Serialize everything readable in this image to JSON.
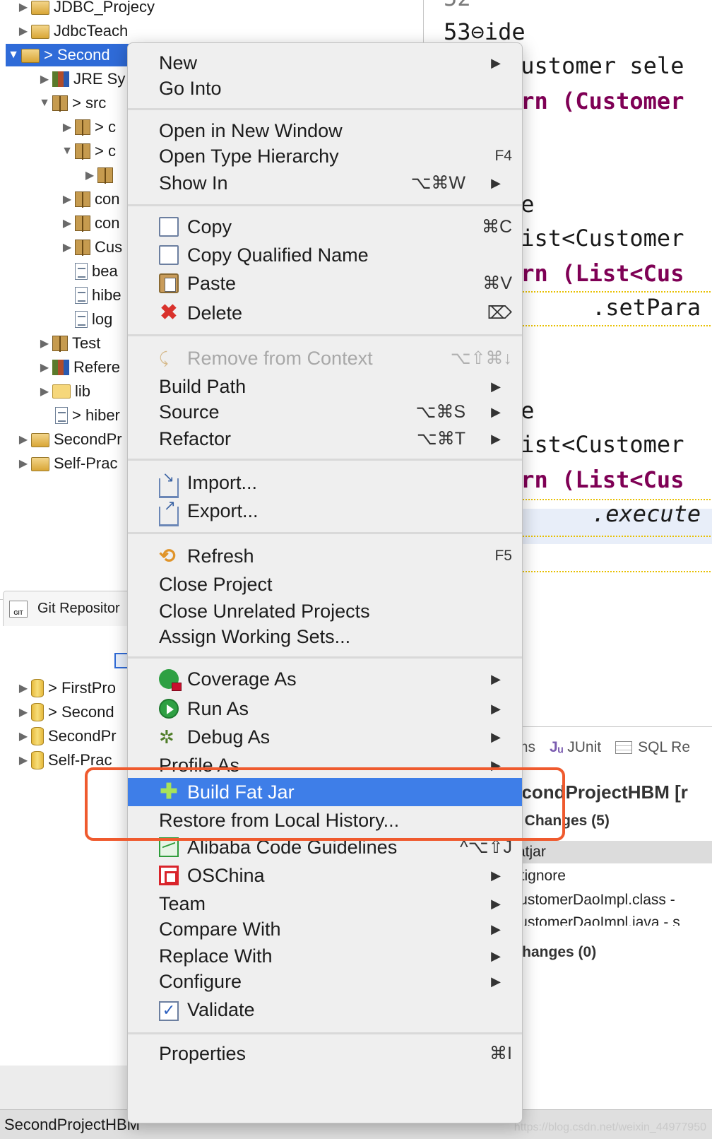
{
  "explorer": {
    "rows": [
      {
        "label": "JDBC_Projecy"
      },
      {
        "label": "JdbcTeach"
      },
      {
        "label": "> Second"
      },
      {
        "label": "JRE Sy"
      },
      {
        "label": "> src"
      },
      {
        "label": "> c"
      },
      {
        "label": "> c"
      },
      {
        "label": ""
      },
      {
        "label": "con"
      },
      {
        "label": "con"
      },
      {
        "label": "Cus"
      },
      {
        "label": "bea"
      },
      {
        "label": "hibe"
      },
      {
        "label": "log"
      },
      {
        "label": "Test"
      },
      {
        "label": "Refere"
      },
      {
        "label": "lib"
      },
      {
        "label": "> hiber"
      },
      {
        "label": "SecondPr"
      },
      {
        "label": "Self-Prac"
      }
    ]
  },
  "git_view": {
    "tab_label": "Git Repositor",
    "logo_text": "GIT",
    "rows": [
      {
        "label": "> FirstPro"
      },
      {
        "label": "> Second"
      },
      {
        "label": "SecondPr"
      },
      {
        "label": "Self-Prac"
      }
    ]
  },
  "editor": {
    "lines": [
      {
        "text": "52"
      },
      {
        "text": "53⊖ide"
      },
      {
        "text": "Customer sele"
      },
      {
        "text": "urn (Customer"
      },
      {
        "text": "de"
      },
      {
        "text": "List<Customer"
      },
      {
        "text": "urn (List<Cus"
      },
      {
        "text": ".setPara"
      },
      {
        "text": "de"
      },
      {
        "text": "List<Customer"
      },
      {
        "text": "urn (List<Cus"
      },
      {
        "text": ".execute"
      }
    ]
  },
  "staging": {
    "tabs": [
      "ms",
      "JUnit",
      "SQL Re"
    ],
    "title": "econdProjectHBM [r",
    "unstaged_header": "d Changes (5)",
    "files": [
      "atjar",
      "itignore",
      "CustomerDaoImpl.class -",
      "CustomerDaoImpl.java - s"
    ],
    "staged_header": "Changes (0)"
  },
  "menu": {
    "items": {
      "new": {
        "label": "New",
        "arrow": "▶"
      },
      "go_into": {
        "label": "Go Into"
      },
      "open_new_window": {
        "label": "Open in New Window"
      },
      "open_type_hierarchy": {
        "label": "Open Type Hierarchy",
        "shortcut": "F4"
      },
      "show_in": {
        "label": "Show In",
        "shortcut": "⌥⌘W",
        "arrow": "▶"
      },
      "copy": {
        "label": "Copy",
        "shortcut": "⌘C",
        "icon": "copy-icon"
      },
      "copy_qualified": {
        "label": "Copy Qualified Name",
        "icon": "copy-qualified-icon"
      },
      "paste": {
        "label": "Paste",
        "shortcut": "⌘V",
        "icon": "paste-icon"
      },
      "delete": {
        "label": "Delete",
        "shortcut": "⌦",
        "icon": "delete-icon"
      },
      "remove_context": {
        "label": "Remove from Context",
        "shortcut": "⌥⇧⌘↓",
        "icon": "remove-context-icon"
      },
      "build_path": {
        "label": "Build Path",
        "arrow": "▶"
      },
      "source": {
        "label": "Source",
        "shortcut": "⌥⌘S",
        "arrow": "▶"
      },
      "refactor": {
        "label": "Refactor",
        "shortcut": "⌥⌘T",
        "arrow": "▶"
      },
      "import": {
        "label": "Import...",
        "icon": "import-icon"
      },
      "export": {
        "label": "Export...",
        "icon": "export-icon"
      },
      "refresh": {
        "label": "Refresh",
        "shortcut": "F5",
        "icon": "refresh-icon"
      },
      "close_project": {
        "label": "Close Project"
      },
      "close_unrelated": {
        "label": "Close Unrelated Projects"
      },
      "assign_working_sets": {
        "label": "Assign Working Sets..."
      },
      "coverage_as": {
        "label": "Coverage As",
        "arrow": "▶",
        "icon": "coverage-icon"
      },
      "run_as": {
        "label": "Run As",
        "arrow": "▶",
        "icon": "run-icon"
      },
      "debug_as": {
        "label": "Debug As",
        "arrow": "▶",
        "icon": "debug-icon"
      },
      "profile_as": {
        "label": "Profile As",
        "arrow": "▶"
      },
      "build_fat_jar": {
        "label": "Build Fat Jar",
        "icon": "fat-jar-icon"
      },
      "restore_history": {
        "label": "Restore from Local History..."
      },
      "alibaba": {
        "label": "Alibaba Code Guidelines",
        "shortcut": "^⌥⇧J",
        "icon": "alibaba-icon"
      },
      "oschina": {
        "label": "OSChina",
        "arrow": "▶",
        "icon": "oschina-icon"
      },
      "team": {
        "label": "Team",
        "arrow": "▶"
      },
      "compare_with": {
        "label": "Compare With",
        "arrow": "▶"
      },
      "replace_with": {
        "label": "Replace With",
        "arrow": "▶"
      },
      "configure": {
        "label": "Configure",
        "arrow": "▶"
      },
      "validate": {
        "label": "Validate",
        "icon": "validate-icon"
      },
      "properties": {
        "label": "Properties",
        "shortcut": "⌘I"
      }
    }
  },
  "status_bar": {
    "selection": "SecondProjectHBM",
    "watermark": "https://blog.csdn.net/weixin_44977950"
  },
  "colors": {
    "selection_blue": "#2f6bd8",
    "menu_highlight": "#3e7ee8",
    "annotation_box": "#ef5a2e",
    "keyword": "#7f0055"
  }
}
